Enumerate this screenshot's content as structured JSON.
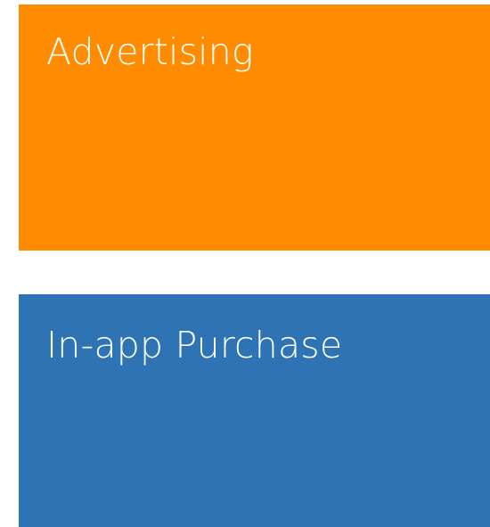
{
  "tiles": [
    {
      "label": "Advertising",
      "color": "#ff8c00"
    },
    {
      "label": "In-app Purchase",
      "color": "#2e74b5"
    }
  ]
}
